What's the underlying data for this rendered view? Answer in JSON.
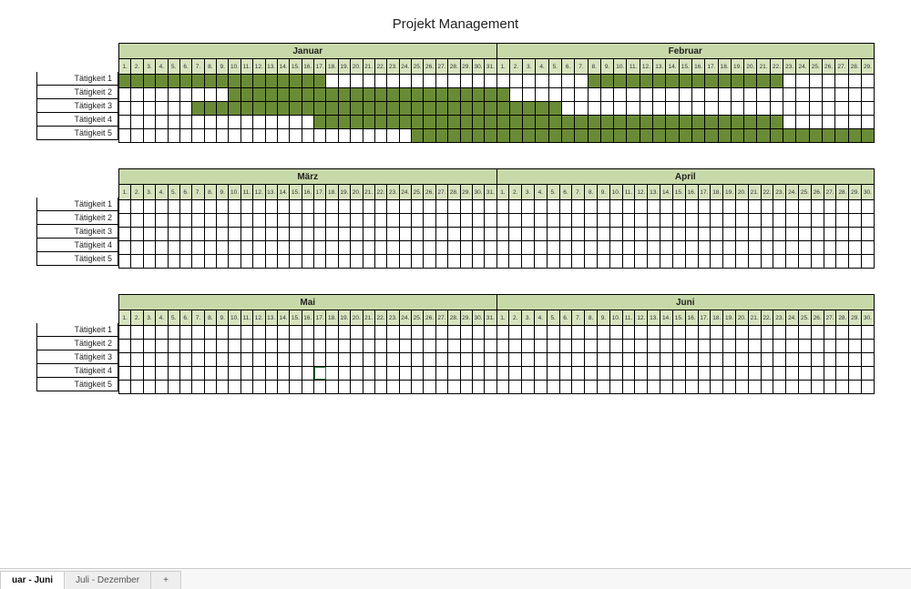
{
  "title": "Projekt Management",
  "activities": [
    "Tätigkeit 1",
    "Tätigkeit 2",
    "Tätigkeit 3",
    "Tätigkeit 4",
    "Tätigkeit 5"
  ],
  "blocks": [
    {
      "months": [
        {
          "name": "Januar",
          "days": 31
        },
        {
          "name": "Februar",
          "days": 29
        }
      ]
    },
    {
      "months": [
        {
          "name": "März",
          "days": 31
        },
        {
          "name": "April",
          "days": 30
        }
      ]
    },
    {
      "months": [
        {
          "name": "Mai",
          "days": 31
        },
        {
          "name": "Juni",
          "days": 30
        }
      ]
    }
  ],
  "bars": {
    "0": {
      "0": {
        "Januar": [
          1,
          17
        ],
        "Februar": [
          8,
          22
        ]
      },
      "1": {
        "Januar": [
          10,
          31
        ],
        "Februar": [
          1,
          1
        ]
      },
      "2": {
        "Januar": [
          7,
          31
        ],
        "Februar": [
          1,
          5
        ]
      },
      "3": {
        "Januar": [
          17,
          31
        ],
        "Februar": [
          1,
          22
        ]
      },
      "4": {
        "Januar": [
          25,
          31
        ],
        "Februar": [
          1,
          29
        ]
      }
    }
  },
  "selected_cell": {
    "block": 2,
    "month": "Mai",
    "row": 3,
    "day": 17
  },
  "tabs": {
    "active": "uar - Juni",
    "others": [
      "Juli - Dezember"
    ],
    "add": "+"
  },
  "chart_data": {
    "type": "gantt",
    "title": "Projekt Management",
    "months": [
      "Januar",
      "Februar",
      "März",
      "April",
      "Mai",
      "Juni"
    ],
    "days_in_month": {
      "Januar": 31,
      "Februar": 29,
      "März": 31,
      "April": 30,
      "Mai": 31,
      "Juni": 30
    },
    "series": [
      {
        "name": "Tätigkeit 1",
        "bars": [
          {
            "month": "Januar",
            "start": 1,
            "end": 17
          },
          {
            "month": "Februar",
            "start": 8,
            "end": 22
          }
        ]
      },
      {
        "name": "Tätigkeit 2",
        "bars": [
          {
            "month": "Januar",
            "start": 10,
            "end": 31
          },
          {
            "month": "Februar",
            "start": 1,
            "end": 1
          }
        ]
      },
      {
        "name": "Tätigkeit 3",
        "bars": [
          {
            "month": "Januar",
            "start": 7,
            "end": 31
          },
          {
            "month": "Februar",
            "start": 1,
            "end": 5
          }
        ]
      },
      {
        "name": "Tätigkeit 4",
        "bars": [
          {
            "month": "Januar",
            "start": 17,
            "end": 31
          },
          {
            "month": "Februar",
            "start": 1,
            "end": 22
          }
        ]
      },
      {
        "name": "Tätigkeit 5",
        "bars": [
          {
            "month": "Januar",
            "start": 25,
            "end": 31
          },
          {
            "month": "Februar",
            "start": 1,
            "end": 29
          }
        ]
      }
    ]
  }
}
